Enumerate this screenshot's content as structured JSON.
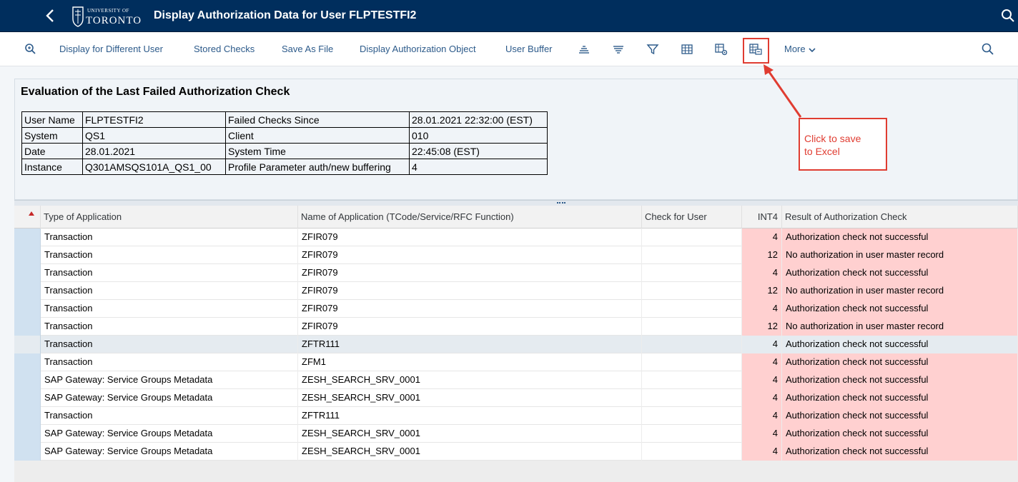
{
  "shell": {
    "university_small": "UNIVERSITY OF",
    "university_big": "TORONTO",
    "title": "Display Authorization Data for User FLPTESTFI2"
  },
  "toolbar": {
    "items": [
      "Display for Different User",
      "Stored Checks",
      "Save As File",
      "Display Authorization Object",
      "User Buffer"
    ],
    "more": "More"
  },
  "panel": {
    "title": "Evaluation of the Last Failed Authorization Check",
    "rows": [
      [
        "User Name",
        "FLPTESTFI2",
        "Failed Checks Since",
        "28.01.2021 22:32:00 (EST)"
      ],
      [
        "System",
        "QS1",
        "Client",
        "010"
      ],
      [
        "Date",
        "28.01.2021",
        "System Time",
        "22:45:08 (EST)"
      ],
      [
        "Instance",
        "Q301AMSQS101A_QS1_00",
        "Profile Parameter auth/new buffering",
        "4"
      ]
    ]
  },
  "grid": {
    "headers": {
      "type": "Type of Application",
      "name": "Name of Application (TCode/Service/RFC Function)",
      "check": "Check for User",
      "int4": "INT4",
      "result": "Result of Authorization Check"
    },
    "rows": [
      {
        "type": "Transaction",
        "name": "ZFIR079",
        "check": "",
        "int4": "4",
        "result": "Authorization check not successful",
        "red": true
      },
      {
        "type": "Transaction",
        "name": "ZFIR079",
        "check": "",
        "int4": "12",
        "result": "No authorization in user master record",
        "red": true
      },
      {
        "type": "Transaction",
        "name": "ZFIR079",
        "check": "",
        "int4": "4",
        "result": "Authorization check not successful",
        "red": true
      },
      {
        "type": "Transaction",
        "name": "ZFIR079",
        "check": "",
        "int4": "12",
        "result": "No authorization in user master record",
        "red": true
      },
      {
        "type": "Transaction",
        "name": "ZFIR079",
        "check": "",
        "int4": "4",
        "result": "Authorization check not successful",
        "red": true
      },
      {
        "type": "Transaction",
        "name": "ZFIR079",
        "check": "",
        "int4": "12",
        "result": "No authorization in user master record",
        "red": true
      },
      {
        "type": "Transaction",
        "name": "ZFTR111",
        "check": "",
        "int4": "4",
        "result": "Authorization check not successful",
        "red": false
      },
      {
        "type": "Transaction",
        "name": "ZFM1",
        "check": "",
        "int4": "4",
        "result": "Authorization check not successful",
        "red": true
      },
      {
        "type": "SAP Gateway: Service Groups Metadata",
        "name": "ZESH_SEARCH_SRV_0001",
        "check": "",
        "int4": "4",
        "result": "Authorization check not successful",
        "red": true
      },
      {
        "type": "SAP Gateway: Service Groups Metadata",
        "name": "ZESH_SEARCH_SRV_0001",
        "check": "",
        "int4": "4",
        "result": "Authorization check not successful",
        "red": true
      },
      {
        "type": "Transaction",
        "name": "ZFTR111",
        "check": "",
        "int4": "4",
        "result": "Authorization check not successful",
        "red": true
      },
      {
        "type": "SAP Gateway: Service Groups Metadata",
        "name": "ZESH_SEARCH_SRV_0001",
        "check": "",
        "int4": "4",
        "result": "Authorization check not successful",
        "red": true
      },
      {
        "type": "SAP Gateway: Service Groups Metadata",
        "name": "ZESH_SEARCH_SRV_0001",
        "check": "",
        "int4": "4",
        "result": "Authorization check not successful",
        "red": true
      }
    ]
  },
  "annotation": {
    "line1": "Click to save",
    "line2": "to Excel"
  },
  "colors": {
    "shell": "#002e5d",
    "link": "#2c5a8a",
    "error_row": "#ffd0d0",
    "annotation": "#e03c31"
  },
  "icons": [
    "back-icon",
    "university-crest-icon",
    "zoom-icon",
    "sort-ascending-icon",
    "sort-descending-icon",
    "filter-icon",
    "grid-icon",
    "grid-settings-icon",
    "export-spreadsheet-icon",
    "chevron-down-icon",
    "search-icon"
  ]
}
